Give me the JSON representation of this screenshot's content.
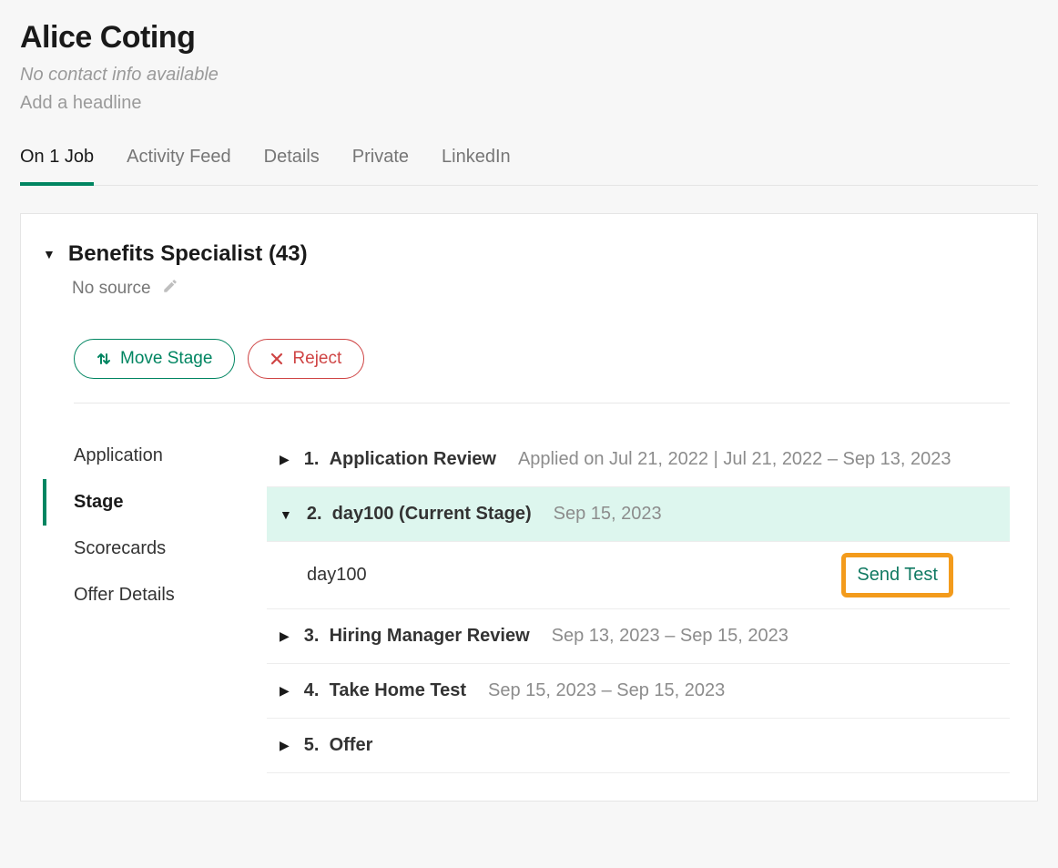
{
  "candidate": {
    "name": "Alice Coting",
    "contact_info": "No contact info available",
    "headline_prompt": "Add a headline"
  },
  "tabs": {
    "on_job": "On 1 Job",
    "activity_feed": "Activity Feed",
    "details": "Details",
    "private": "Private",
    "linkedin": "LinkedIn"
  },
  "job": {
    "title": "Benefits Specialist (43)",
    "source": "No source"
  },
  "buttons": {
    "move_stage": "Move Stage",
    "reject": "Reject",
    "send_test": "Send Test"
  },
  "sidebar": {
    "application": "Application",
    "stage": "Stage",
    "scorecards": "Scorecards",
    "offer_details": "Offer Details"
  },
  "stages": {
    "s1": {
      "num": "1.",
      "title": "Application Review",
      "meta": "Applied on Jul 21, 2022 | Jul 21, 2022 – Sep 13, 2023"
    },
    "s2": {
      "num": "2.",
      "title": "day100 (Current Stage)",
      "meta": "Sep 15, 2023",
      "sub_label": "day100"
    },
    "s3": {
      "num": "3.",
      "title": "Hiring Manager Review",
      "meta": "Sep 13, 2023 – Sep 15, 2023"
    },
    "s4": {
      "num": "4.",
      "title": "Take Home Test",
      "meta": "Sep 15, 2023 – Sep 15, 2023"
    },
    "s5": {
      "num": "5.",
      "title": "Offer"
    }
  }
}
